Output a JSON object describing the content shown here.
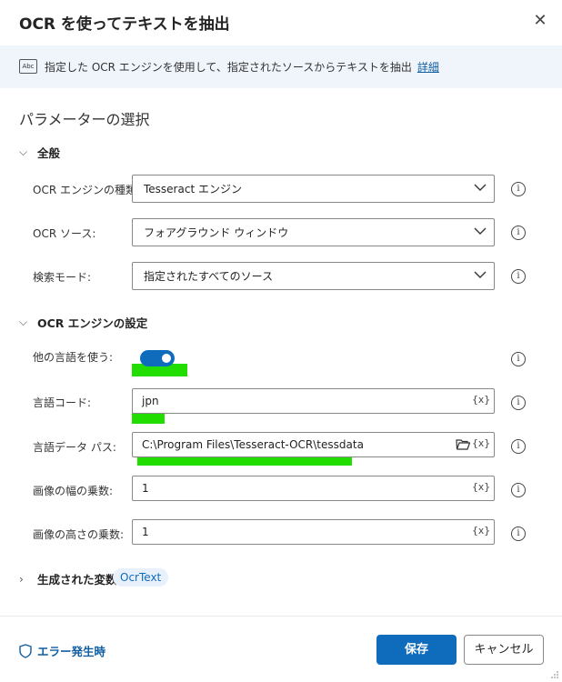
{
  "dialog": {
    "title": "OCR を使ってテキストを抽出",
    "close_glyph": "✕"
  },
  "banner": {
    "icon_text": "Abc",
    "text": "指定した OCR エンジンを使用して、指定されたソースからテキストを抽出",
    "link": "詳細"
  },
  "section_title": "パラメーターの選択",
  "groups": {
    "general": "全般",
    "engine_settings": "OCR エンジンの設定",
    "variables": "生成された変数"
  },
  "fields": {
    "engine_type": {
      "label": "OCR エンジンの種類:",
      "value": "Tesseract エンジン"
    },
    "ocr_source": {
      "label": "OCR ソース:",
      "value": "フォアグラウンド ウィンドウ"
    },
    "search_mode": {
      "label": "検索モード:",
      "value": "指定されたすべてのソース"
    },
    "use_other_language": {
      "label": "他の言語を使う:",
      "state": "on"
    },
    "language_code": {
      "label": "言語コード:",
      "value": "jpn"
    },
    "language_data_path": {
      "label": "言語データ パス:",
      "value": "C:\\Program Files\\Tesseract-OCR\\tessdata"
    },
    "image_width_multiplier": {
      "label": "画像の幅の乗数:",
      "value": "1"
    },
    "image_height_multiplier": {
      "label": "画像の高さの乗数:",
      "value": "1"
    }
  },
  "variable_pill": "OcrText",
  "fx_glyph": "{x}",
  "info_glyph": "i",
  "footer": {
    "on_error": "エラー発生時",
    "save": "保存",
    "cancel": "キャンセル"
  },
  "colors": {
    "accent": "#0f6cbd",
    "highlight": "#22dd00",
    "banner_bg": "#f0f5fb"
  }
}
